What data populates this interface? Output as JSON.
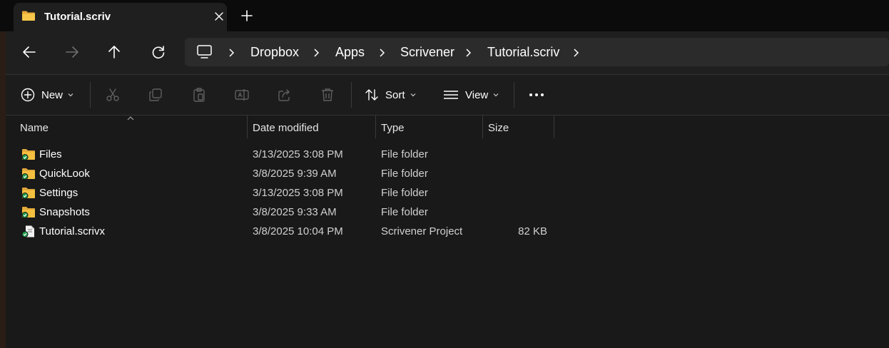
{
  "tab": {
    "title": "Tutorial.scriv"
  },
  "breadcrumbs": [
    "Dropbox",
    "Apps",
    "Scrivener",
    "Tutorial.scriv"
  ],
  "toolbar": {
    "new_label": "New",
    "sort_label": "Sort",
    "view_label": "View"
  },
  "columns": {
    "name": "Name",
    "date": "Date modified",
    "type": "Type",
    "size": "Size"
  },
  "files": [
    {
      "name": "Files",
      "date": "3/13/2025 3:08 PM",
      "type": "File folder",
      "size": "",
      "icon": "folder-icon"
    },
    {
      "name": "QuickLook",
      "date": "3/8/2025 9:39 AM",
      "type": "File folder",
      "size": "",
      "icon": "folder-icon"
    },
    {
      "name": "Settings",
      "date": "3/13/2025 3:08 PM",
      "type": "File folder",
      "size": "",
      "icon": "folder-icon"
    },
    {
      "name": "Snapshots",
      "date": "3/8/2025 9:33 AM",
      "type": "File folder",
      "size": "",
      "icon": "folder-icon"
    },
    {
      "name": "Tutorial.scrivx",
      "date": "3/8/2025 10:04 PM",
      "type": "Scrivener Project",
      "size": "82 KB",
      "icon": "file-icon"
    }
  ],
  "colors": {
    "folder": "#f5c040",
    "sync_badge": "#1e9e4a",
    "background": "#191919",
    "accent": "#ffffff"
  }
}
